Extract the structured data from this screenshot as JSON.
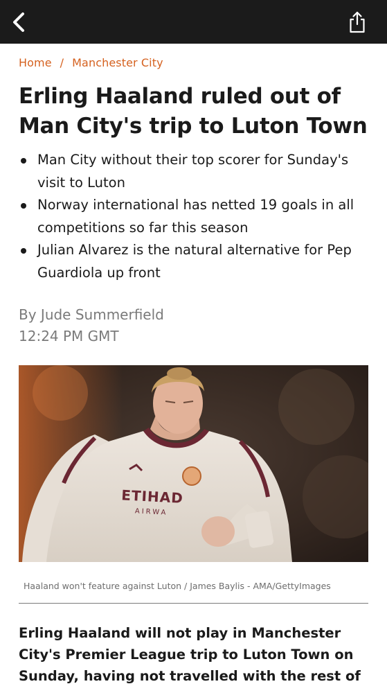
{
  "nav": {
    "back_icon": "chevron-left-icon",
    "share_icon": "share-icon"
  },
  "breadcrumb": {
    "home": "Home",
    "separator": "/",
    "section": "Manchester City"
  },
  "article": {
    "headline": "Erling Haaland ruled out of Man City's trip to Luton Town",
    "bullets": [
      "Man City without their top scorer for Sunday's visit to Luton",
      "Norway international has netted 19 goals in all competitions so far this season",
      "Julian Alvarez is the natural alternative for Pep Guardiola up front"
    ],
    "author": "By Jude Summerfield",
    "time": "12:24 PM GMT",
    "image": {
      "shirt_text": "ETIHAD",
      "shirt_subtext": "AIRWA"
    },
    "caption": "Haaland won't feature against Luton / James Baylis - AMA/GettyImages",
    "lead": "Erling Haaland will not play in Manchester City's Premier League trip to Luton Town on Sunday, having not travelled with the rest of"
  },
  "colors": {
    "topbar": "#1b1b1b",
    "accent": "#d5611f",
    "text": "#1a1a1a",
    "muted": "#7a7a7a"
  }
}
